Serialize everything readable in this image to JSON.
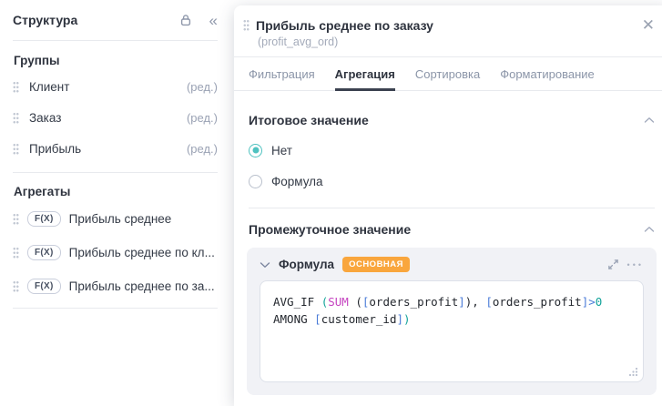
{
  "colors": {
    "accent_teal": "#4fc2c0",
    "badge_orange": "#f9a63d",
    "text_dark": "#2e333e",
    "text_muted": "#9aa2b4",
    "tab_inactive": "#8b95a8",
    "code_default": "#23272e",
    "code_magenta": "#c544c0",
    "code_blue": "#4a7bd8",
    "code_teal": "#13a39a"
  },
  "sidebar": {
    "title": "Структура",
    "collapse_glyph": "«",
    "groups_header": "Группы",
    "edit_label": "(ред.)",
    "groups": [
      {
        "label": "Клиент"
      },
      {
        "label": "Заказ"
      },
      {
        "label": "Прибыль"
      }
    ],
    "aggregates_header": "Агрегаты",
    "aggregate_badge": "F(X)",
    "aggregates": [
      {
        "label": "Прибыль среднее"
      },
      {
        "label": "Прибыль среднее по кл..."
      },
      {
        "label": "Прибыль среднее по за..."
      }
    ]
  },
  "panel": {
    "title": "Прибыль среднее по заказу",
    "subtitle": "(profit_avg_ord)",
    "close_glyph": "✕",
    "tabs": [
      {
        "label": "Фильтрация"
      },
      {
        "label": "Агрегация"
      },
      {
        "label": "Сортировка"
      },
      {
        "label": "Форматирование"
      }
    ],
    "active_tab": "Агрегация",
    "total_section": {
      "title": "Итоговое значение",
      "options": [
        {
          "label": "Нет",
          "selected": true
        },
        {
          "label": "Формула",
          "selected": false
        }
      ]
    },
    "intermediate_section": {
      "title": "Промежуточное значение",
      "formula_label": "Формула",
      "badge": "ОСНОВНАЯ",
      "menu_glyph": "•••",
      "code_lines": [
        [
          {
            "t": "AVG_IF ",
            "c": "default"
          },
          {
            "t": "(",
            "c": "teal"
          },
          {
            "t": "SUM",
            "c": "magenta"
          },
          {
            "t": " (",
            "c": "default"
          },
          {
            "t": "[",
            "c": "blue"
          },
          {
            "t": "orders_profit",
            "c": "default"
          },
          {
            "t": "]",
            "c": "blue"
          },
          {
            "t": "), ",
            "c": "default"
          },
          {
            "t": "[",
            "c": "blue"
          },
          {
            "t": "orders_profit",
            "c": "default"
          },
          {
            "t": "]",
            "c": "blue"
          },
          {
            "t": ">",
            "c": "blue"
          },
          {
            "t": "0",
            "c": "teal"
          }
        ],
        [
          {
            "t": "AMONG ",
            "c": "default"
          },
          {
            "t": "[",
            "c": "blue"
          },
          {
            "t": "customer_id",
            "c": "default"
          },
          {
            "t": "]",
            "c": "blue"
          },
          {
            "t": ")",
            "c": "teal"
          }
        ]
      ]
    }
  }
}
